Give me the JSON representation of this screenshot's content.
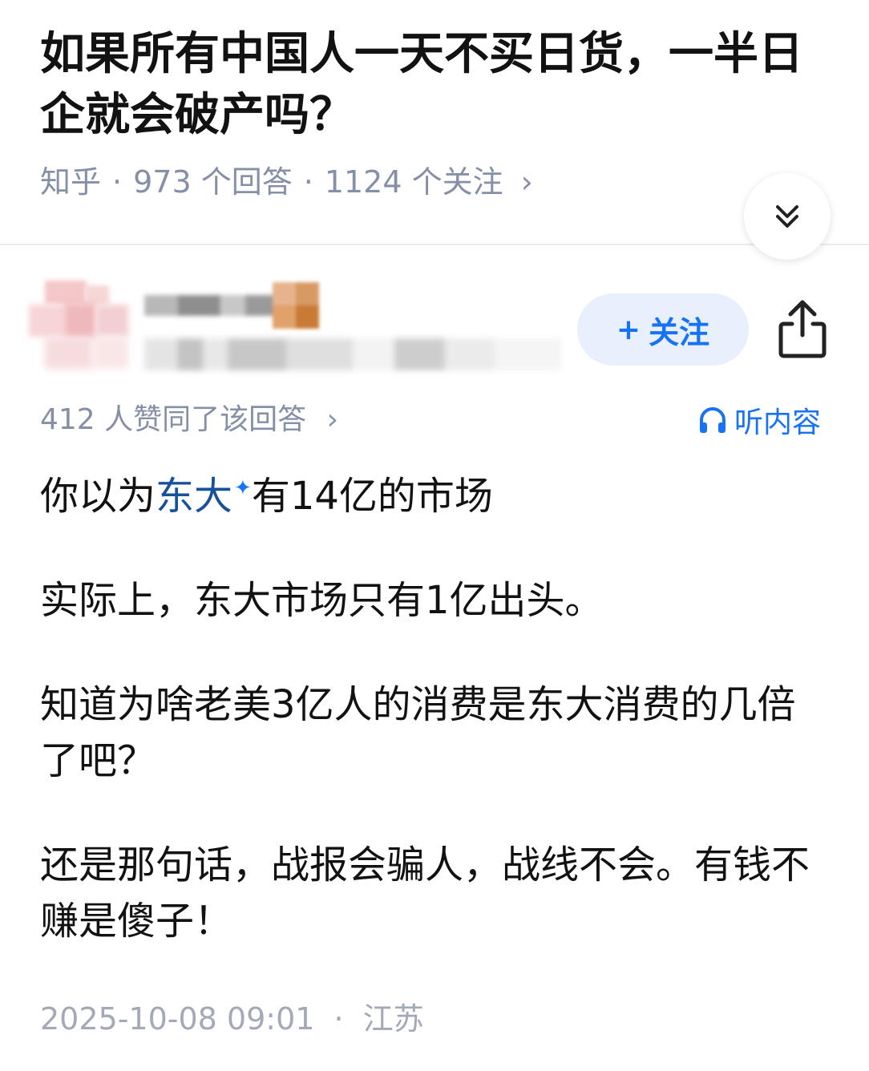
{
  "question": {
    "title": "如果所有中国人一天不买日货，一半日企就会破产吗？",
    "source": "知乎",
    "answers": "973 个回答",
    "followers": "1124 个关注",
    "separator": "·",
    "chevron": "›"
  },
  "author": {
    "follow_label": "关注",
    "follow_plus": "+"
  },
  "answer": {
    "votes": "412 人赞同了该回答",
    "listen_label": "听内容",
    "paragraphs": [
      {
        "before": "你以为",
        "link": "东大",
        "spark": "✦",
        "after": "有14亿的市场"
      },
      {
        "text": "实际上，东大市场只有1亿出头。"
      },
      {
        "text": "知道为啥老美3亿人的消费是东大消费的几倍了吧？"
      },
      {
        "text": "还是那句话，战报会骗人，战线不会。有钱不赚是傻子！"
      }
    ],
    "date": "2025-10-08 09:01",
    "location": "江苏"
  },
  "colors": {
    "primary_blue": "#1772f6",
    "link_blue": "#175199",
    "meta_gray": "#8590a6",
    "text": "#121212"
  }
}
